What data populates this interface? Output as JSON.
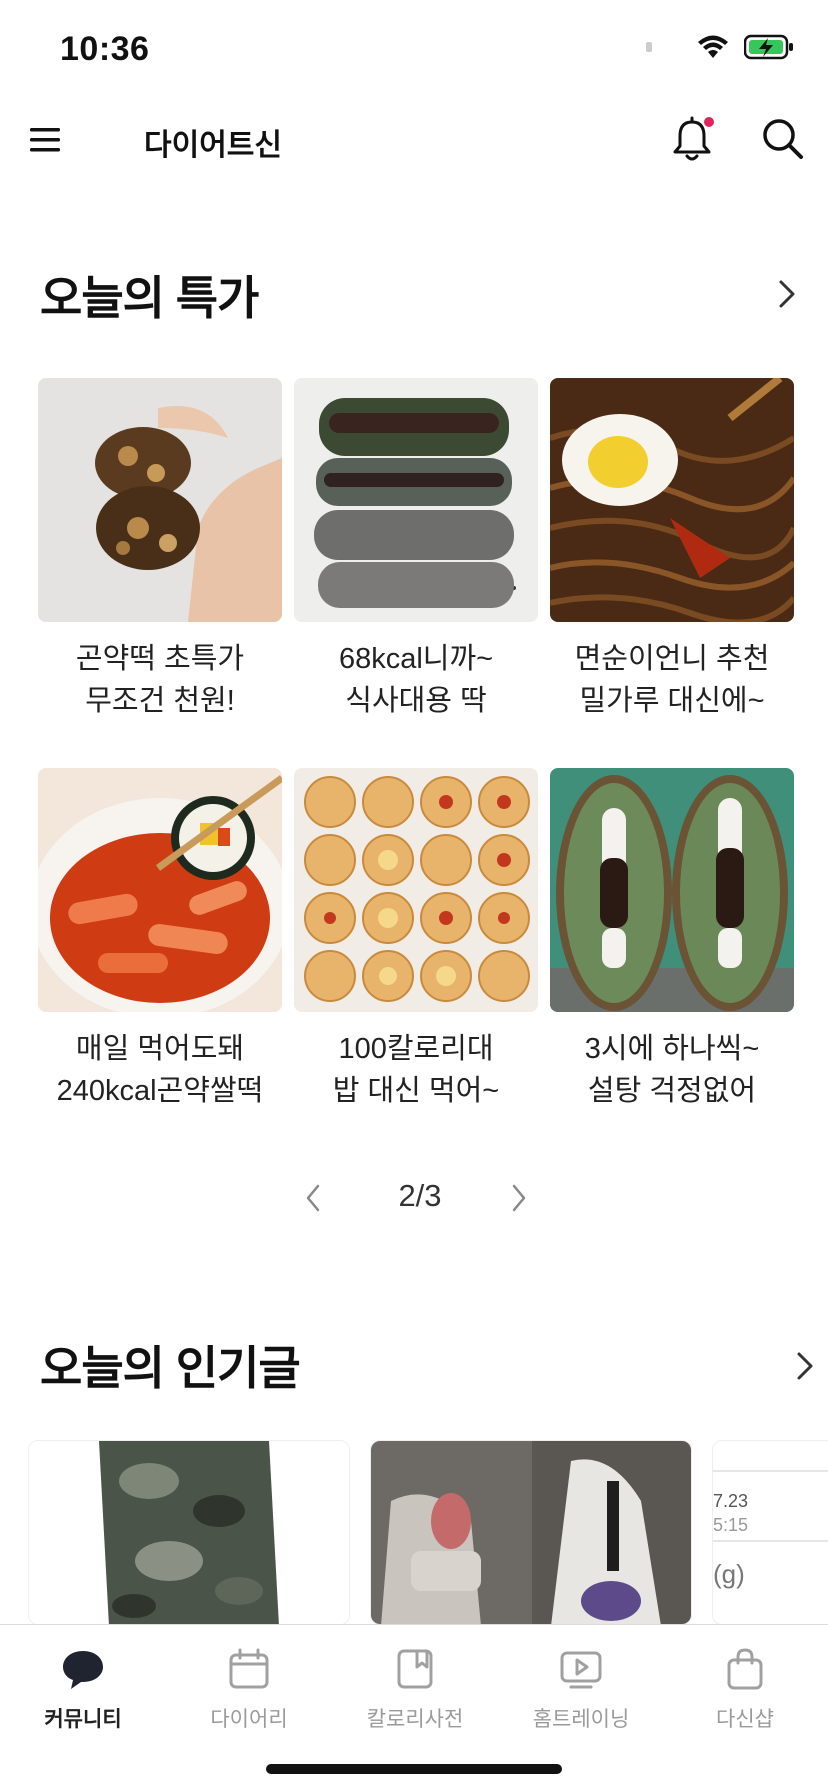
{
  "status_bar": {
    "time": "10:36"
  },
  "app": {
    "title": "다이어트신",
    "notification_dot_color": "#e0245e"
  },
  "deals_section": {
    "title": "오늘의 특가",
    "items": [
      {
        "line1": "곤약떡 초특가",
        "line2": "무조건 천원!"
      },
      {
        "line1": "68kcal니까~",
        "line2": "식사대용 딱"
      },
      {
        "line1": "면순이언니 추천",
        "line2": "밀가루 대신에~"
      },
      {
        "line1": "매일 먹어도돼",
        "line2": "240kcal곤약쌀떡"
      },
      {
        "line1": "100칼로리대",
        "line2": "밥 대신 먹어~"
      },
      {
        "line1": "3시에 하나씩~",
        "line2": "설탕 걱정없어"
      }
    ],
    "pager": "2/3"
  },
  "popular_section": {
    "title": "오늘의 인기글",
    "preview_text": [
      "7.23",
      "5:15",
      "(g)"
    ]
  },
  "bottom_nav": [
    {
      "label": "커뮤니티",
      "icon": "chat-bubble-icon",
      "active": true
    },
    {
      "label": "다이어리",
      "icon": "calendar-icon",
      "active": false
    },
    {
      "label": "칼로리사전",
      "icon": "book-icon",
      "active": false
    },
    {
      "label": "홈트레이닝",
      "icon": "play-video-icon",
      "active": false
    },
    {
      "label": "다신샵",
      "icon": "shopping-bag-icon",
      "active": false
    }
  ]
}
